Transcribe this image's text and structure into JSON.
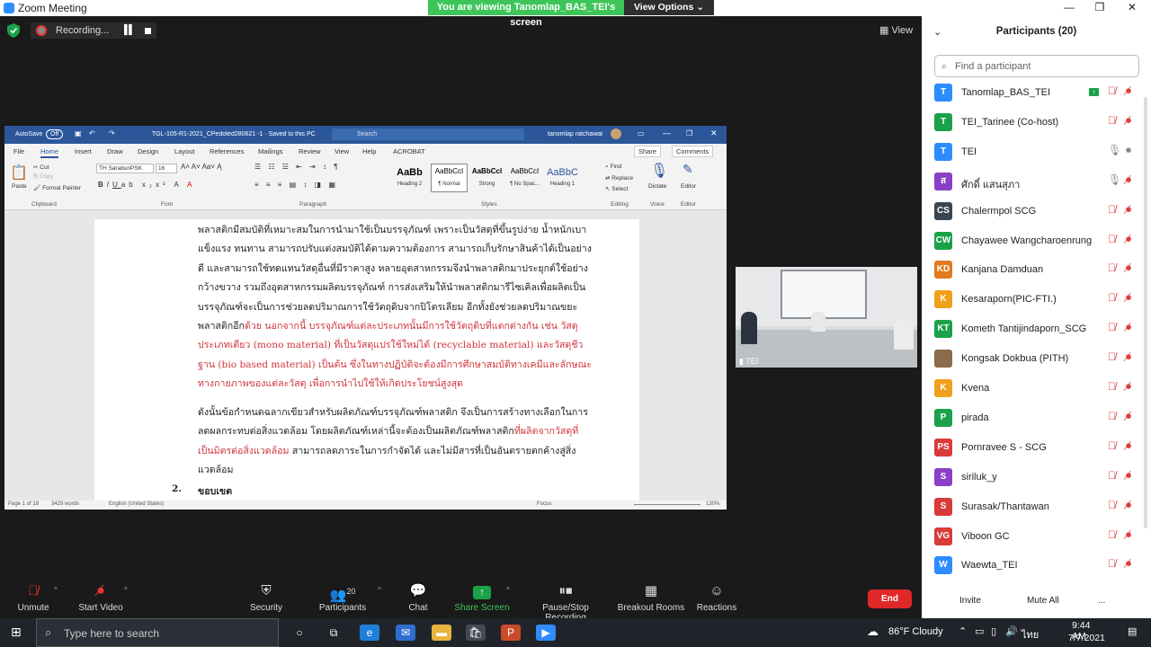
{
  "titlebar": {
    "app_title": "Zoom Meeting",
    "share_banner": "You are viewing Tanomlap_BAS_TEI's screen",
    "view_options": "View Options"
  },
  "recording": {
    "label": "Recording..."
  },
  "view": {
    "label": "View"
  },
  "word": {
    "autosave": "AutoSave",
    "autosave_state": "Off",
    "doc_title": "TGL-105-R1-2021_CPedoted280621 -1  ·  Saved to this PC",
    "search": "Search",
    "user": "tanomlap ratchawat",
    "menu": [
      "File",
      "Home",
      "Insert",
      "Draw",
      "Design",
      "Layout",
      "References",
      "Mailings",
      "Review",
      "View",
      "Help",
      "ACROBAT"
    ],
    "share": "Share",
    "comments": "Comments",
    "clipboard": {
      "paste": "Paste",
      "cut": "Cut",
      "copy": "Copy",
      "painter": "Format Painter",
      "group": "Clipboard"
    },
    "font": {
      "name": "TH SarabunPSK",
      "size": "16",
      "group": "Font"
    },
    "paragraph_group": "Paragraph",
    "styles": [
      {
        "sample": "AaBb",
        "name": "Heading 2"
      },
      {
        "sample": "AaBbCcI",
        "name": "¶ Normal"
      },
      {
        "sample": "AaBbCcI",
        "name": "Strong"
      },
      {
        "sample": "AaBbCcI",
        "name": "¶ No Spac..."
      },
      {
        "sample": "AaBbC",
        "name": "Heading 1"
      }
    ],
    "styles_group": "Styles",
    "editing": {
      "find": "Find",
      "replace": "Replace",
      "select": "Select",
      "group": "Editing"
    },
    "voice": {
      "dictate": "Dictate",
      "group": "Voice"
    },
    "editor": {
      "label": "Editor",
      "group": "Editor"
    },
    "para1_black": "พลาสติกมีสมบัติที่เหมาะสมในการนำมาใช้เป็นบรรจุภัณฑ์ เพราะเป็นวัสดุที่ขึ้นรูปง่าย น้ำหนักเบา แข็งแรง ทนทาน สามารถปรับแต่งสมบัติได้ตามความต้องการ สามารถเก็บรักษาสินค้าได้เป็นอย่างดี และสามารถใช้ทดแทนวัสดุอื่นที่มีราคาสูง หลายอุตสาหกรรมจึงนำพลาสติกมาประยุกต์ใช้อย่างกว้างขวาง รวมถึงอุตสาหกรรมผลิตบรรจุภัณฑ์ การส่งเสริมให้นำพลาสติกมารีไซเคิลเพื่อผลิตเป็นบรรจุภัณฑ์จะเป็นการช่วยลดปริมาณการใช้วัตถุดิบจากปิโตรเลียม  อีกทั้งยังช่วยลดปริมาณขยะพลาสติกอีก",
    "para1_red": "ด้วย นอกจากนี้ บรรจุภัณฑ์แต่ละประเภทนั้นมีการใช้วัตถุดิบที่แตกต่างกัน เช่น วัสดุประเภทเดียว (mono material) ที่เป็นวัสดุแปรใช้ใหม่ได้ (recyclable material) และวัสดุชีวฐาน (bio based material) เป็นต้น ซึ่งในทางปฏิบัติจะต้องมีการศึกษาสมบัติทางเคมีและลักษณะทางกายภาพของแต่ละวัสดุ เพื่อการนำไปใช้ให้เกิดประโยชน์สูงสุด",
    "para2_a": "ดังนั้นข้อกำหนดฉลากเขียวสำหรับผลิตภัณฑ์บรรจุภัณฑ์พลาสติก จึงเป็นการสร้างทางเลือกในการลดผลกระทบต่อสิ่งแวดล้อม โดยผลิตภัณฑ์เหล่านี้จะต้องเป็นผลิตภัณฑ์พลาสติก",
    "para2_red": "ที่ผลิตจากวัสดุที่เป็นมิตรต่อสิ่งแวดล้อม",
    "para2_b": " สามารถลดภาระในการกำจัดได้ และไม่มีสารที่เป็นอันตรายตกค้างสู่สิ่งแวดล้อม",
    "section_num": "2.",
    "section_title": "ขอบเขต",
    "status": {
      "page": "Page 1 of 18",
      "words": "3429 words",
      "lang": "English (United States)",
      "focus": "Focus",
      "zoom": "130%"
    }
  },
  "camera": {
    "name": "TEI"
  },
  "participants": {
    "title": "Participants (20)",
    "search_placeholder": "Find a participant",
    "list": [
      {
        "initials": "T",
        "name": "Tanomlap_BAS_TEI",
        "color": "#2d8cff",
        "mic": "muted",
        "video": "off",
        "sharing": true
      },
      {
        "initials": "T",
        "name": "TEI_Tarinee (Co-host)",
        "color": "#1aa14a",
        "mic": "muted",
        "video": "off"
      },
      {
        "initials": "T",
        "name": "TEI",
        "color": "#2d8cff",
        "mic": "on",
        "video": "on"
      },
      {
        "initials": "ส",
        "name": "ศักดิ์ แสนสุภา",
        "color": "#8a3fc7",
        "mic": "on",
        "video": "off"
      },
      {
        "initials": "CS",
        "name": "Chalermpol SCG",
        "color": "#3c4650",
        "mic": "muted",
        "video": "off"
      },
      {
        "initials": "CW",
        "name": "Chayawee Wangcharoenrung",
        "color": "#1aa14a",
        "mic": "muted",
        "video": "off"
      },
      {
        "initials": "KD",
        "name": "Kanjana Damduan",
        "color": "#e07a1c",
        "mic": "muted",
        "video": "off"
      },
      {
        "initials": "K",
        "name": "Kesaraporn(PIC-FTI.)",
        "color": "#f0a01c",
        "mic": "muted",
        "video": "off"
      },
      {
        "initials": "KT",
        "name": "Kometh Tantijindaporn_SCG",
        "color": "#1aa14a",
        "mic": "muted",
        "video": "off"
      },
      {
        "initials": "",
        "name": "Kongsak Dokbua (PITH)",
        "color": "#8b6b4a",
        "mic": "muted",
        "video": "off",
        "photo": true
      },
      {
        "initials": "K",
        "name": "Kvena",
        "color": "#f0a01c",
        "mic": "muted",
        "video": "off"
      },
      {
        "initials": "P",
        "name": "pirada",
        "color": "#1aa14a",
        "mic": "muted",
        "video": "off"
      },
      {
        "initials": "PS",
        "name": "Pornravee S - SCG",
        "color": "#d93a3a",
        "mic": "muted",
        "video": "off"
      },
      {
        "initials": "S",
        "name": "siriluk_y",
        "color": "#8a3fc7",
        "mic": "muted",
        "video": "off"
      },
      {
        "initials": "S",
        "name": "Surasak/Thantawan",
        "color": "#d93a3a",
        "mic": "muted",
        "video": "off"
      },
      {
        "initials": "VG",
        "name": "Viboon GC",
        "color": "#d93a3a",
        "mic": "muted",
        "video": "off"
      },
      {
        "initials": "W",
        "name": "Waewta_TEI",
        "color": "#2d8cff",
        "mic": "muted",
        "video": "off"
      }
    ],
    "invite": "Invite",
    "mute_all": "Mute All",
    "more": "..."
  },
  "toolbar": {
    "unmute": "Unmute",
    "start_video": "Start Video",
    "security": "Security",
    "participants": "Participants",
    "participants_count": "20",
    "chat": "Chat",
    "share_screen": "Share Screen",
    "pause_stop": "Pause/Stop Recording",
    "breakout": "Breakout Rooms",
    "reactions": "Reactions",
    "end": "End"
  },
  "taskbar": {
    "search": "Type here to search",
    "weather": "86°F  Cloudy",
    "lang": "ไทย",
    "time": "9:44 AM",
    "date": "7/7/2021"
  }
}
